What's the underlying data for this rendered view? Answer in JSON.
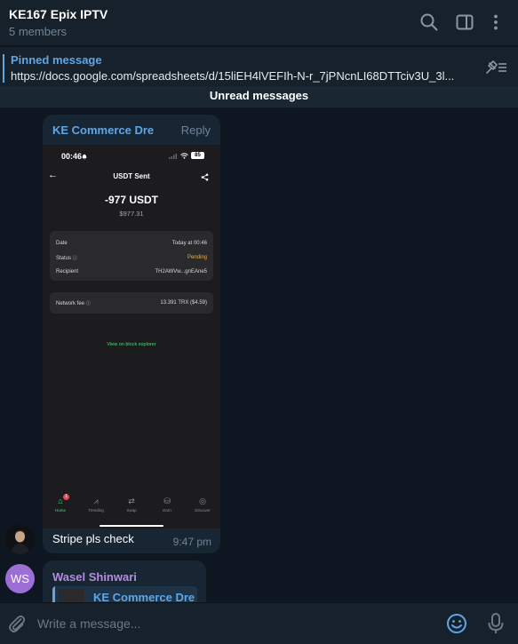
{
  "header": {
    "title": "KE167 Epix IPTV",
    "subtitle": "5 members",
    "icons": [
      "search-icon",
      "sidebar-toggle-icon",
      "more-icon"
    ]
  },
  "pinned": {
    "label": "Pinned message",
    "text": "https://docs.google.com/spreadsheets/d/15liEH4lVEFIh-N-r_7jPNcnLI68DTTciv3U_3l..."
  },
  "unread_divider": "Unread messages",
  "messages": [
    {
      "sender": "KE Commerce Dre",
      "reply_label": "Reply",
      "caption": "Stripe pls check",
      "time": "9:47 pm",
      "screenshot": {
        "status_time": "00:46",
        "battery": "85",
        "title": "USDT Sent",
        "amount": "-977 USDT",
        "usd": "$977.31",
        "rows": [
          {
            "label": "Date",
            "value": "Today at 00:46"
          },
          {
            "label": "Status",
            "value": "Pending"
          },
          {
            "label": "Recipient",
            "value": "TH2AWVw...gnEAne5"
          }
        ],
        "fee": {
          "label": "Network fee",
          "value": "13.391 TRX ($4.59)"
        },
        "explorer": "View on block explorer",
        "nav": [
          {
            "label": "Home",
            "badge": "1"
          },
          {
            "label": "Trending"
          },
          {
            "label": "Swap"
          },
          {
            "label": "Earn"
          },
          {
            "label": "Discover"
          }
        ]
      }
    },
    {
      "sender": "Wasel Shinwari",
      "avatar_initials": "WS",
      "avatar_color": "#9b6fd6",
      "forwarded_from": "KE Commerce Dre"
    }
  ],
  "composer": {
    "placeholder": "Write a message..."
  },
  "colors": {
    "accent": "#5ea6e6",
    "background": "#0e1621",
    "panel": "#17212b",
    "bubble": "#182533"
  }
}
